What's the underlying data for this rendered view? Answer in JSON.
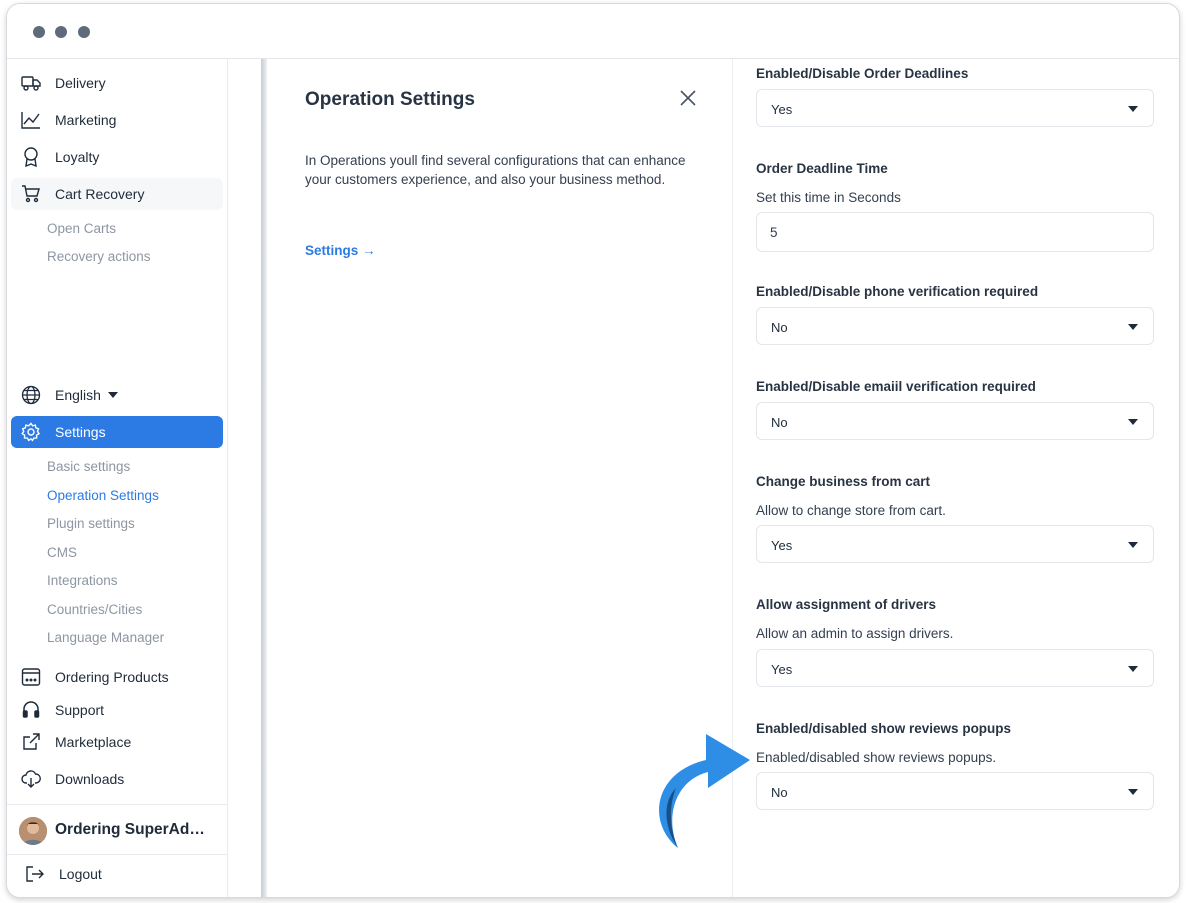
{
  "sidebar": {
    "top_items": [
      {
        "label": "Delivery",
        "icon": "truck-icon"
      },
      {
        "label": "Marketing",
        "icon": "chart-line-icon"
      },
      {
        "label": "Loyalty",
        "icon": "award-icon"
      },
      {
        "label": "Cart Recovery",
        "icon": "cart-icon"
      }
    ],
    "cart_sub": [
      "Open Carts",
      "Recovery actions"
    ],
    "language": "English",
    "settings_label": "Settings",
    "settings_sub": [
      "Basic settings",
      "Operation Settings",
      "Plugin settings",
      "CMS",
      "Integrations",
      "Countries/Cities",
      "Language Manager"
    ],
    "bottom_items": [
      {
        "label": "Ordering Products",
        "icon": "storefront-icon"
      },
      {
        "label": "Support",
        "icon": "headset-icon"
      },
      {
        "label": "Marketplace",
        "icon": "external-link-icon"
      },
      {
        "label": "Downloads",
        "icon": "cloud-download-icon"
      }
    ],
    "user_name": "Ordering SuperAd…",
    "logout": "Logout"
  },
  "info": {
    "title": "Operation Settings",
    "description": "In Operations youll find several configurations that can enhance your customers experience, and also your business method.",
    "link": "Settings →"
  },
  "form": [
    {
      "title": "Enabled/Disable Order Deadlines",
      "value": "Yes"
    },
    {
      "title": "Order Deadline Time",
      "desc": "Set this time in Seconds",
      "value": "5"
    },
    {
      "title": "Enabled/Disable phone verification required",
      "value": "No"
    },
    {
      "title": "Enabled/Disable emaiil verification required",
      "value": "No"
    },
    {
      "title": "Change business from cart",
      "desc": "Allow to change store from cart.",
      "value": "Yes"
    },
    {
      "title": "Allow assignment of drivers",
      "desc": "Allow an admin to assign drivers.",
      "value": "Yes"
    },
    {
      "title": "Enabled/disabled show reviews popups",
      "desc": "Enabled/disabled show reviews popups.",
      "value": "No"
    }
  ],
  "colors": {
    "accent": "#2c7be5",
    "callout_arrow": "#2e8ee6"
  }
}
